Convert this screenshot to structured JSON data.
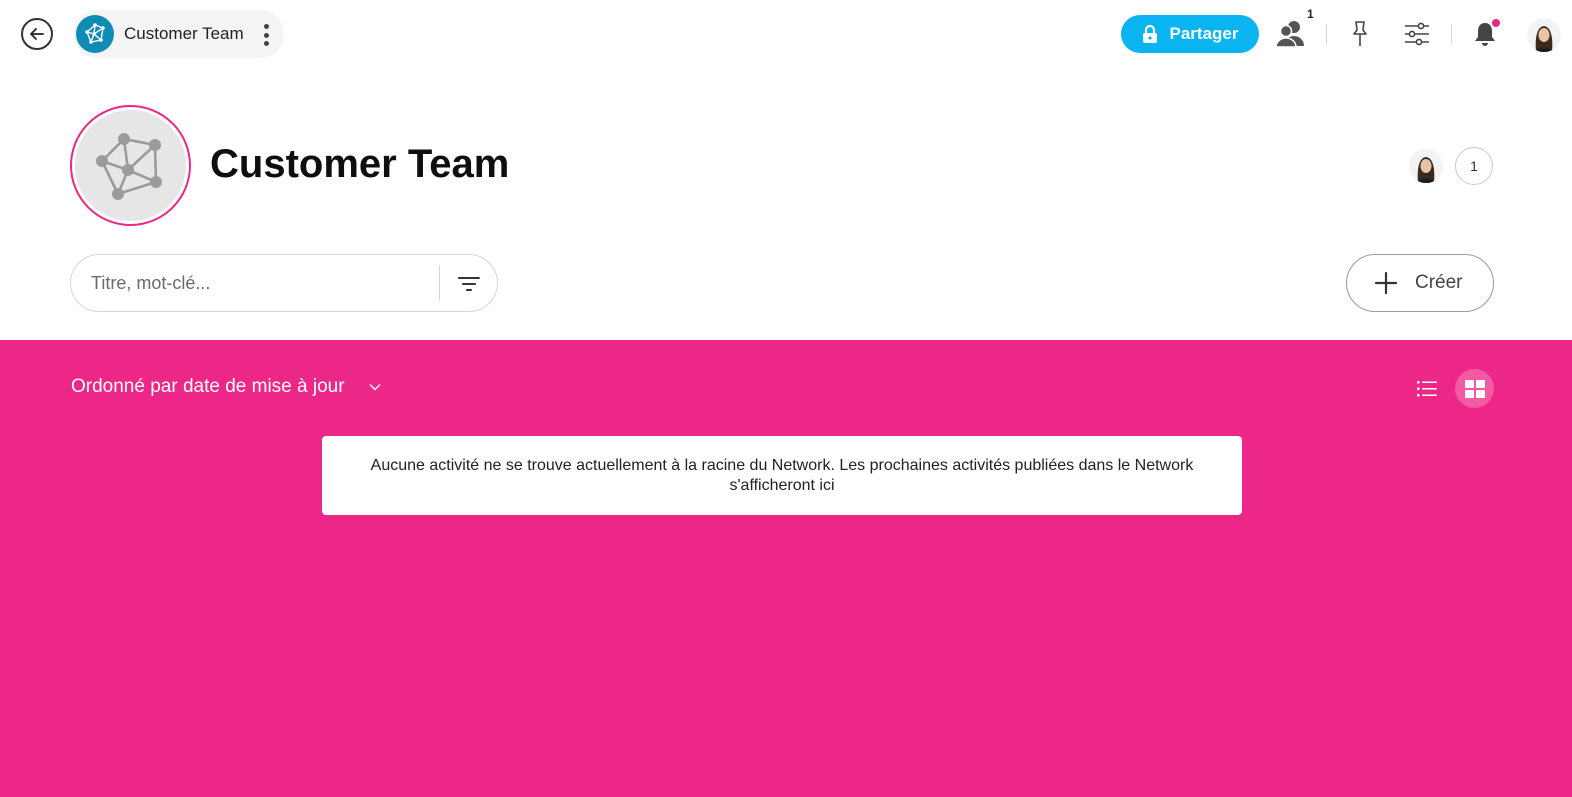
{
  "topbar": {
    "breadcrumb_title": "Customer Team",
    "share_label": "Partager",
    "members_count": "1",
    "icons": [
      "back-arrow-icon",
      "network-icon",
      "more-vertical-icon",
      "lock-icon",
      "members-icon",
      "pin-icon",
      "settings-sliders-icon",
      "bell-icon"
    ],
    "accent_color": "#0ab4f0",
    "notification_dot_color": "#ec2787"
  },
  "header": {
    "title": "Customer Team",
    "member_count": "1"
  },
  "search": {
    "placeholder": "Titre, mot-clé...",
    "value": ""
  },
  "actions": {
    "create_label": "Créer"
  },
  "content": {
    "background_color": "#ec2787",
    "sort_label": "Ordonné par date de mise à jour",
    "active_view": "grid",
    "empty_message": "Aucune activité ne se trouve actuellement à la racine du Network. Les prochaines activités publiées dans le Network s'afficheront ici"
  }
}
